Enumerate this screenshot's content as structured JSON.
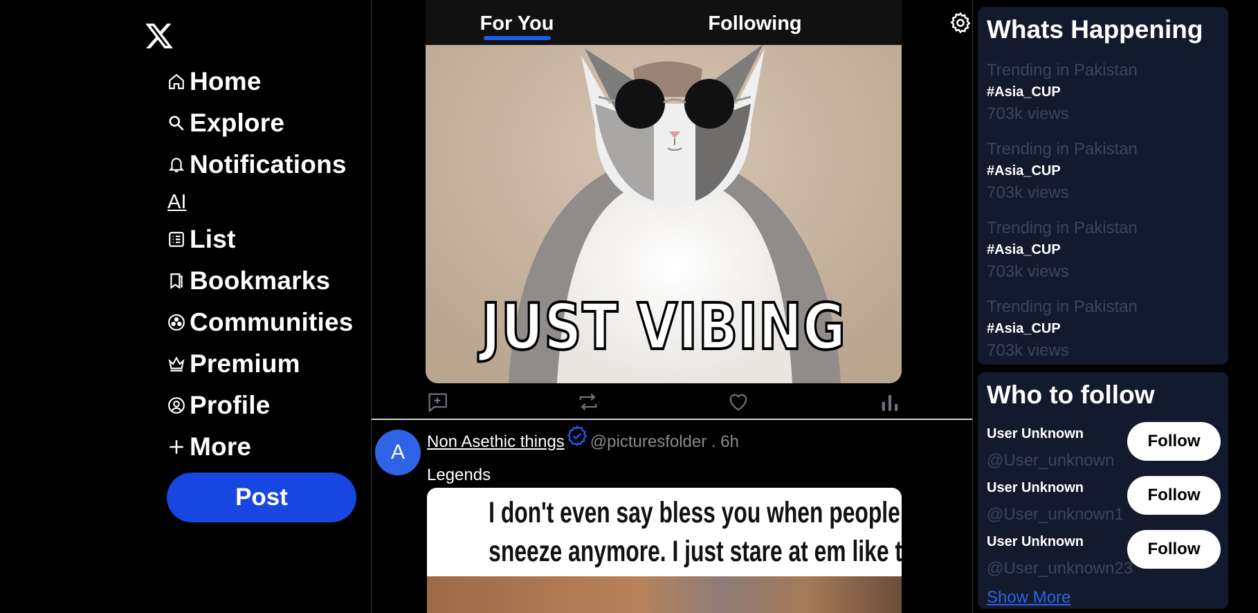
{
  "sidebar": {
    "logo": "x-logo",
    "items": [
      {
        "label": "Home",
        "icon": "home-icon"
      },
      {
        "label": "Explore",
        "icon": "search-icon"
      },
      {
        "label": "Notifications",
        "icon": "bell-icon"
      },
      {
        "label": "AI",
        "icon": ""
      },
      {
        "label": "List",
        "icon": "list-icon"
      },
      {
        "label": "Bookmarks",
        "icon": "bookmark-icon"
      },
      {
        "label": "Communities",
        "icon": "communities-icon"
      },
      {
        "label": "Premium",
        "icon": "crown-icon"
      },
      {
        "label": "Profile",
        "icon": "profile-icon"
      },
      {
        "label": "More",
        "icon": "plus-icon"
      }
    ],
    "post_label": "Post"
  },
  "feed": {
    "tabs": [
      {
        "label": "For You",
        "active": true
      },
      {
        "label": "Following",
        "active": false
      }
    ],
    "post1": {
      "caption": "JUST VIBING"
    },
    "post2": {
      "avatar_letter": "A",
      "name": "Non Asethic things",
      "handle": "@picturesfolder . 6h",
      "text": "Legends",
      "meme_lines": [
        "I don't even say bless you when people",
        "sneeze anymore. I just stare at em like this..."
      ]
    }
  },
  "whats_happening": {
    "title": "Whats Happening",
    "trends": [
      {
        "context": "Trending in Pakistan",
        "tag": "#Asia_CUP",
        "views": "703k views"
      },
      {
        "context": "Trending in Pakistan",
        "tag": "#Asia_CUP",
        "views": "703k views"
      },
      {
        "context": "Trending in Pakistan",
        "tag": "#Asia_CUP",
        "views": "703k views"
      },
      {
        "context": "Trending in Pakistan",
        "tag": "#Asia_CUP",
        "views": "703k views"
      }
    ]
  },
  "who_to_follow": {
    "title": "Who to follow",
    "users": [
      {
        "name": "User Unknown",
        "handle": "@User_unknown",
        "button": "Follow"
      },
      {
        "name": "User Unknown",
        "handle": "@User_unknown1",
        "button": "Follow"
      },
      {
        "name": "User Unknown",
        "handle": "@User_unknown23",
        "button": "Follow"
      }
    ],
    "show_more": "Show More"
  },
  "colors": {
    "accent": "#1746e0",
    "panel_bg": "#131a2e",
    "muted": "#3c4458"
  }
}
